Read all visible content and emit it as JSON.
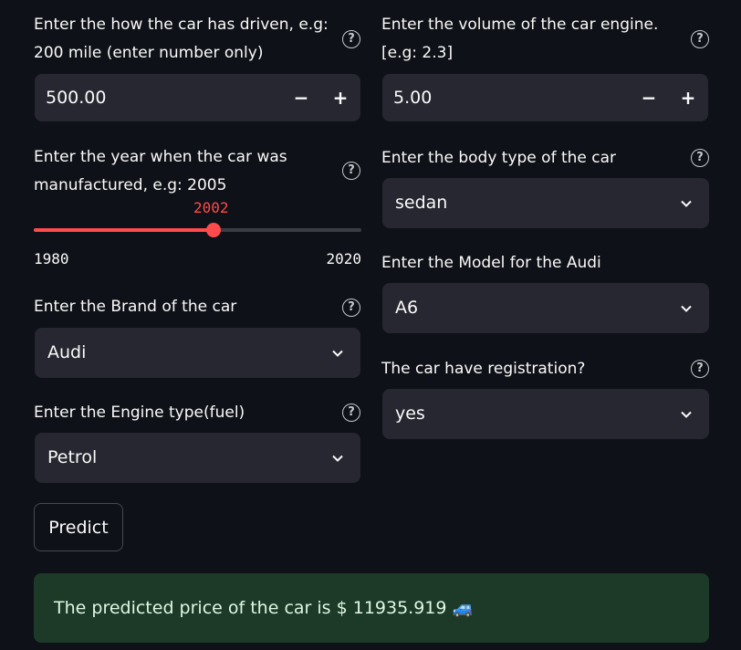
{
  "mileage": {
    "label": "Enter the how the car has driven, e.g: 200 mile (enter number only)",
    "value": "500.00",
    "minus": "−",
    "plus": "+"
  },
  "engine_volume": {
    "label": "Enter the volume of the car engine. [e.g: 2.3]",
    "value": "5.00",
    "minus": "−",
    "plus": "+"
  },
  "year": {
    "label": "Enter the year when the car was manufactured, e.g: 2005",
    "value": "2002",
    "min": "1980",
    "max": "2020",
    "fraction": 0.55,
    "accent": "#ff4b4b"
  },
  "body_type": {
    "label": "Enter the body type of the car",
    "selected": "sedan"
  },
  "model": {
    "label": "Enter the Model for the Audi",
    "selected": "A6"
  },
  "brand": {
    "label": "Enter the Brand of the car",
    "selected": "Audi"
  },
  "registration": {
    "label": "The car have registration?",
    "selected": "yes"
  },
  "engine_type": {
    "label": "Enter the Engine type(fuel)",
    "selected": "Petrol"
  },
  "predict_button": "Predict",
  "result": {
    "text": "The predicted price of the car is $ 11935.919 🚙",
    "background": "#1c3a27",
    "color": "#dff7e4"
  },
  "icons": {
    "help": "question-circle-icon",
    "dropdown": "chevron-down-icon"
  },
  "help_glyph": "?"
}
